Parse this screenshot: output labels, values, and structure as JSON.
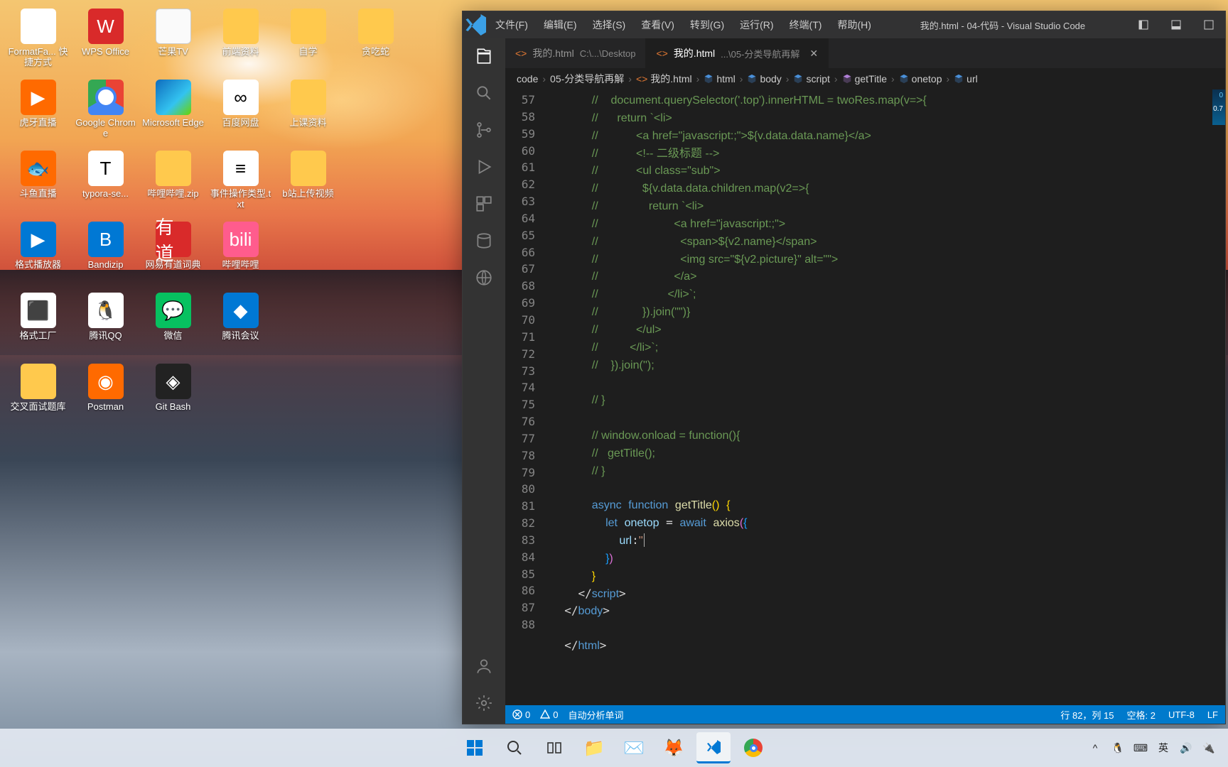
{
  "desktop_icons": [
    {
      "label": "FormatFa...\n快捷方式",
      "cls": "ico-white"
    },
    {
      "label": "WPS Office",
      "cls": "ico-red",
      "glyph": "W"
    },
    {
      "label": "芒果TV",
      "cls": "ico-file"
    },
    {
      "label": "前端资料",
      "cls": "ico-fold"
    },
    {
      "label": "自学",
      "cls": "ico-fold"
    },
    {
      "label": "贪吃蛇",
      "cls": "ico-fold"
    },
    {
      "label": "虎牙直播",
      "cls": "ico-orange",
      "glyph": "▶"
    },
    {
      "label": "Google Chrome",
      "cls": "ico-chrome"
    },
    {
      "label": "Microsoft Edge",
      "cls": "ico-edge"
    },
    {
      "label": "百度网盘",
      "cls": "ico-white",
      "glyph": "∞"
    },
    {
      "label": "上课资料",
      "cls": "ico-fold"
    },
    {
      "label": "",
      "cls": ""
    },
    {
      "label": "斗鱼直播",
      "cls": "ico-orange",
      "glyph": "🐟"
    },
    {
      "label": "typora-se...",
      "cls": "ico-white",
      "glyph": "T"
    },
    {
      "label": "哔哩哔哩.zip",
      "cls": "ico-fold"
    },
    {
      "label": "事件操作类型.txt",
      "cls": "ico-white",
      "glyph": "≡"
    },
    {
      "label": "b站上传视频",
      "cls": "ico-fold"
    },
    {
      "label": "",
      "cls": ""
    },
    {
      "label": "格式播放器",
      "cls": "ico-blue",
      "glyph": "▶"
    },
    {
      "label": "Bandizip",
      "cls": "ico-blue",
      "glyph": "B"
    },
    {
      "label": "网易有道词典",
      "cls": "ico-red",
      "glyph": "有道"
    },
    {
      "label": "哔哩哔哩",
      "cls": "ico-pink",
      "glyph": "bili"
    },
    {
      "label": "",
      "cls": ""
    },
    {
      "label": "",
      "cls": ""
    },
    {
      "label": "格式工厂",
      "cls": "ico-white",
      "glyph": "⬛"
    },
    {
      "label": "腾讯QQ",
      "cls": "ico-white",
      "glyph": "🐧"
    },
    {
      "label": "微信",
      "cls": "ico-green",
      "glyph": "💬"
    },
    {
      "label": "腾讯会议",
      "cls": "ico-blue",
      "glyph": "◆"
    },
    {
      "label": "",
      "cls": ""
    },
    {
      "label": "",
      "cls": ""
    },
    {
      "label": "交叉面试题库",
      "cls": "ico-fold"
    },
    {
      "label": "Postman",
      "cls": "ico-orange",
      "glyph": "◉"
    },
    {
      "label": "Git Bash",
      "cls": "ico-dark",
      "glyph": "◈"
    }
  ],
  "vscode": {
    "window_title": "我的.html - 04-代码 - Visual Studio Code",
    "menus": [
      "文件(F)",
      "编辑(E)",
      "选择(S)",
      "查看(V)",
      "转到(G)",
      "运行(R)",
      "终端(T)",
      "帮助(H)"
    ],
    "tabs": [
      {
        "name": "我的.html",
        "path": "C:\\...\\Desktop",
        "active": false
      },
      {
        "name": "我的.html",
        "path": "...\\05-分类导航再解",
        "active": true
      }
    ],
    "breadcrumbs": [
      "code",
      "05-分类导航再解",
      "我的.html",
      "html",
      "body",
      "script",
      "getTitle",
      "onetop",
      "url"
    ],
    "line_start": 57,
    "line_end": 88,
    "minimap_label": "0",
    "minimap_pct": "0.7",
    "code_lines": [
      "//    document.querySelector('.top').innerHTML = twoRes.map(v=>{",
      "//      return `<li>",
      "//            <a href=\"javascript:;\">${v.data.data.name}</a>",
      "//            <!-- 二级标题 -->",
      "//            <ul class=\"sub\">",
      "//              ${v.data.data.children.map(v2=>{",
      "//                return `<li>",
      "//                        <a href=\"javascript:;\">",
      "//                          <span>${v2.name}</span>",
      "//                          <img src=\"${v2.picture}\" alt=\"\">",
      "//                        </a>",
      "//                      </li>`;",
      "//              }).join(\"\")}",
      "//            </ul>",
      "//          </li>`;",
      "//    }).join('');",
      "",
      "// }",
      "",
      "// window.onload = function(){",
      "//   getTitle();",
      "// }",
      "",
      "",
      "",
      "",
      "",
      "",
      "",
      "",
      "",
      ""
    ],
    "status": {
      "errors": "0",
      "warnings": "0",
      "analyze": "自动分析单词",
      "pos": "行 82，列 15",
      "spaces": "空格: 2",
      "enc": "UTF-8",
      "eol": "LF"
    }
  },
  "taskbar": {
    "tray": [
      "^",
      "🐧",
      "⌨",
      "英",
      "🔊",
      "🔌"
    ]
  }
}
